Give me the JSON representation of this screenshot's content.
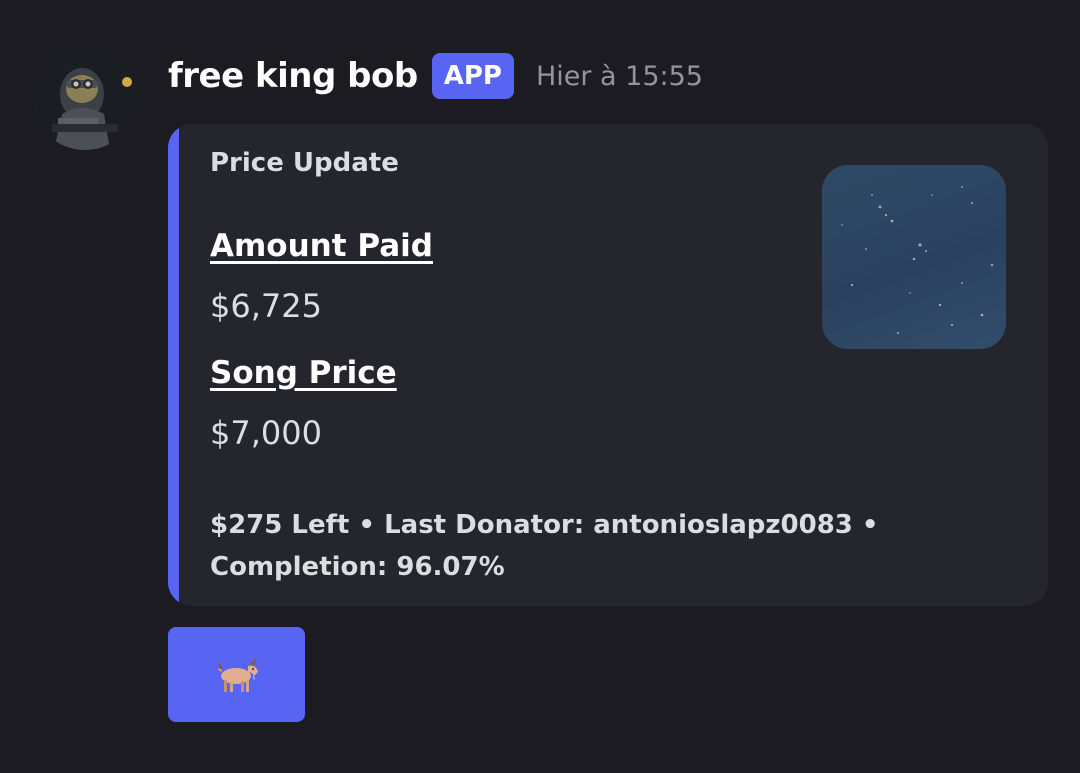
{
  "message": {
    "author": "free king bob",
    "badge": "APP",
    "timestamp": "Hier à 15:55"
  },
  "embed": {
    "title": "Price Update",
    "fields": [
      {
        "name": "Amount Paid",
        "value": "$6,725"
      },
      {
        "name": "Song Price",
        "value": "$7,000"
      }
    ],
    "footer": "$275 Left • Last Donator: antonioslapz0083 • Completion: 96.07%",
    "accent_color": "#5865f2"
  },
  "button": {
    "icon": "goat-icon",
    "color": "#5865f2"
  }
}
